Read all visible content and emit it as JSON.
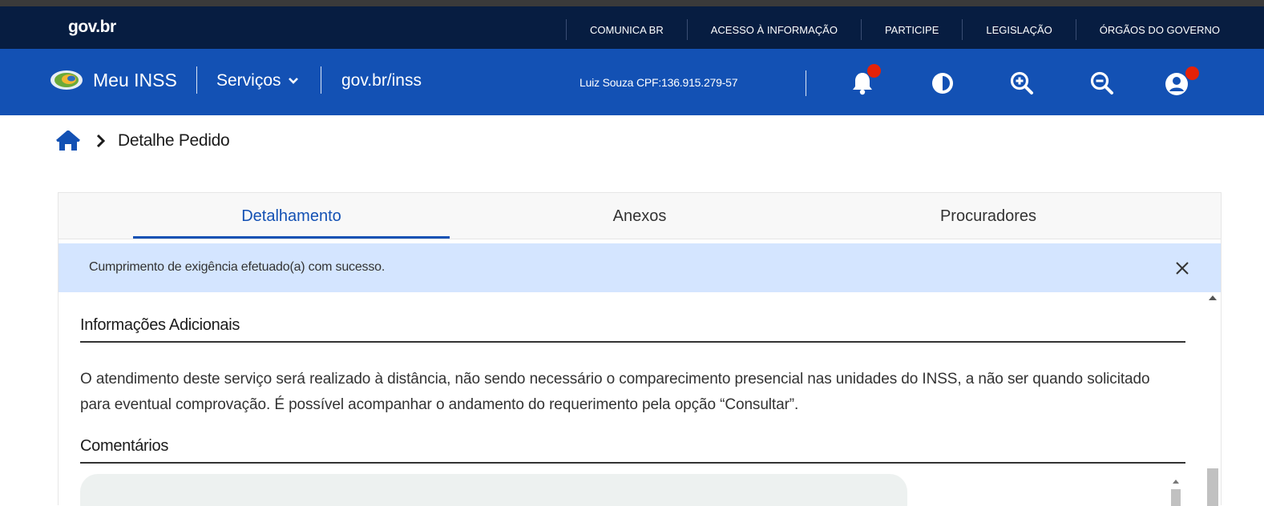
{
  "govbar": {
    "logo": "gov.br",
    "links": [
      "COMUNICA BR",
      "ACESSO À INFORMAÇÃO",
      "PARTICIPE",
      "LEGISLAÇÃO",
      "ÓRGÃOS DO GOVERNO"
    ]
  },
  "header": {
    "brand": "Meu INSS",
    "servicos": "Serviços",
    "govinss": "gov.br/inss",
    "user": "Luiz Souza  CPF:136.915.279-57",
    "icons": [
      "bell-icon",
      "contrast-icon",
      "zoom-in-icon",
      "zoom-out-icon",
      "user-icon"
    ]
  },
  "breadcrumb": {
    "current": "Detalhe Pedido"
  },
  "tabs": [
    "Detalhamento",
    "Anexos",
    "Procuradores"
  ],
  "alert": {
    "message": "Cumprimento de exigência efetuado(a) com sucesso."
  },
  "content": {
    "info_title": "Informações Adicionais",
    "info_text": "O atendimento deste serviço será realizado à distância, não sendo necessário o comparecimento presencial nas unidades do INSS, a não ser quando solicitado para eventual comprovação. É possível acompanhar o andamento do requerimento pela opção “Consultar”.",
    "comments_title": "Comentários"
  },
  "colors": {
    "gov_dark": "#071d41",
    "inss_blue": "#1351b4",
    "alert_bg": "#d4e5ff",
    "notification_dot": "#e52207"
  }
}
